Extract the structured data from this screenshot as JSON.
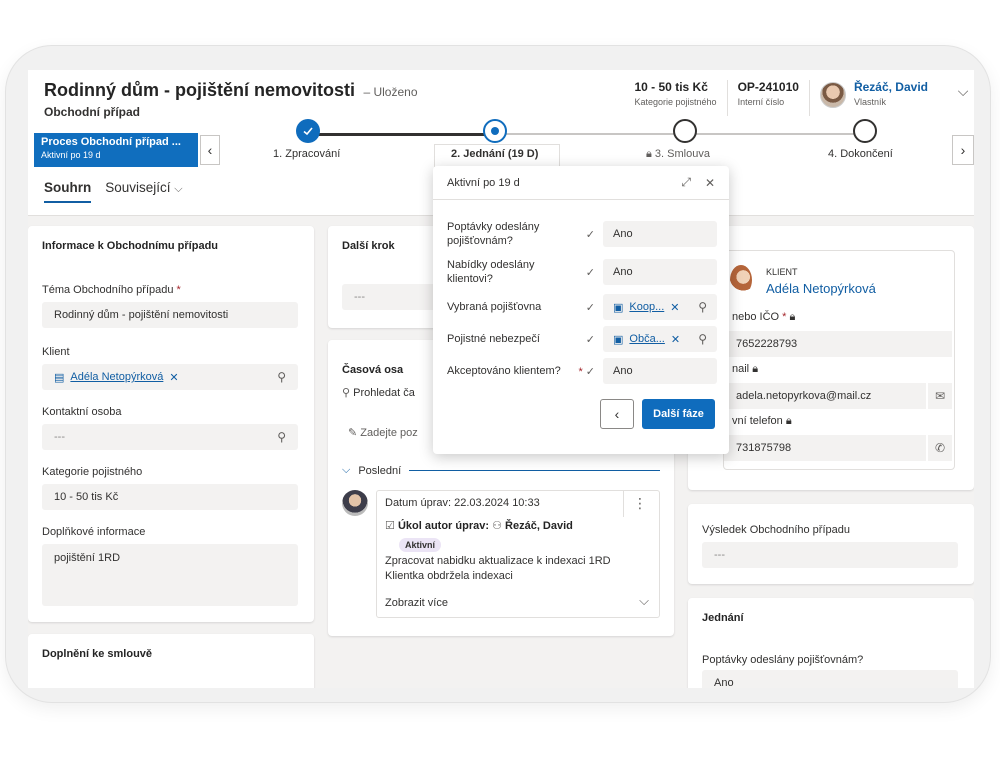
{
  "header": {
    "title": "Rodinný dům - pojištění nemovitosti",
    "saved": "– Uloženo",
    "entity": "Obchodní případ",
    "fields": [
      {
        "value": "10 - 50 tis Kč",
        "label": "Kategorie pojistného"
      },
      {
        "value": "OP-241010",
        "label": "Interní číslo"
      }
    ],
    "owner": {
      "name": "Řezáč, David",
      "label": "Vlastník"
    }
  },
  "bpf": {
    "process_title": "Proces Obchodní případ ...",
    "process_sub": "Aktivní po 19 d",
    "stages": [
      {
        "label": "1. Zpracování",
        "state": "done"
      },
      {
        "label": "2. Jednání  (19 D)",
        "state": "active"
      },
      {
        "label": "3. Smlouva",
        "state": "future"
      },
      {
        "label": "4. Dokončení",
        "state": "future"
      }
    ]
  },
  "tabs": [
    "Souhrn",
    "Související"
  ],
  "info_card": {
    "title": "Informace k Obchodnímu případu",
    "topic_label": "Téma Obchodního případu",
    "topic_value": "Rodinný dům - pojištění nemovitosti",
    "client_label": "Klient",
    "client_value": "Adéla Netopýrková",
    "contact_label": "Kontaktní osoba",
    "contact_value": "---",
    "category_label": "Kategorie pojistného",
    "category_value": "10 - 50 tis Kč",
    "extra_label": "Doplňkové informace",
    "extra_value": "pojištění 1RD"
  },
  "contract_card": {
    "title": "Doplnění ke smlouvě"
  },
  "next_step": {
    "title": "Další krok",
    "value": "---"
  },
  "timeline": {
    "title": "Časová osa",
    "search": "Prohledat ča",
    "note": "Zadejte poz",
    "recent": "Poslední",
    "post": {
      "date": "Datum úprav: 22.03.2024 10:33",
      "task": "Úkol autor úprav:",
      "author": "Řezáč, David",
      "badge": "Aktivní",
      "line1": "Zpracovat nabidku aktualizace k indexaci 1RD",
      "line2": "Klientka obdržela indexaci",
      "more": "Zobrazit více"
    }
  },
  "flyout": {
    "header": "Aktivní po 19 d",
    "rows": [
      {
        "label": "Poptávky odeslány pojišťovnám?",
        "value": "Ano",
        "lookup": false
      },
      {
        "label": "Nabídky odeslány klientovi?",
        "value": "Ano",
        "lookup": false
      },
      {
        "label": "Vybraná pojišťovna",
        "value": "Koop...",
        "lookup": true
      },
      {
        "label": "Pojistné nebezpečí",
        "value": "Obča...",
        "lookup": true
      },
      {
        "label": "Akceptováno klientem?",
        "value": "Ano",
        "lookup": false
      }
    ],
    "next_button": "Další fáze"
  },
  "client": {
    "kicker": "KLIENT",
    "name": "Adéla Netopýrková",
    "rc_label": "nebo IČO",
    "rc_value": "7652228793",
    "email_label": "nail",
    "email_value": "adela.netopyrkova@mail.cz",
    "phone_label": "vní telefon",
    "phone_value": "731875798"
  },
  "result": {
    "title": "Výsledek Obchodního případu",
    "value": "---"
  },
  "jednani": {
    "title": "Jednání",
    "q_label": "Poptávky odeslány pojišťovnám?",
    "q_value": "Ano"
  },
  "colors": {
    "accent": "#0f6cbd",
    "link": "#115ea3",
    "field_bg": "#f3f2f1"
  }
}
